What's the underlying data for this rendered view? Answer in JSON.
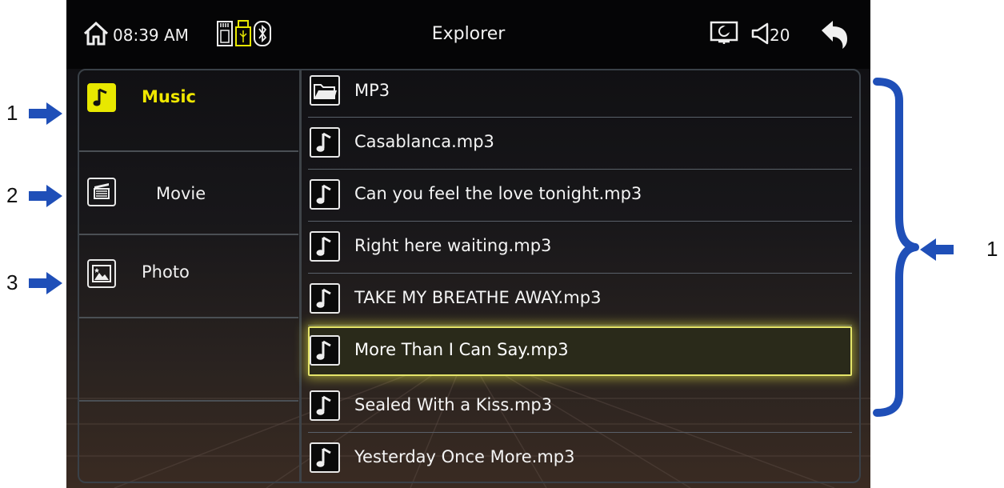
{
  "status_bar": {
    "time": "08:39 AM",
    "title": "Explorer",
    "volume": "20",
    "icons": [
      "home-icon",
      "sd-card-icon",
      "usb-icon",
      "bluetooth-icon",
      "screen-mode-icon",
      "volume-icon",
      "back-icon"
    ]
  },
  "categories": [
    {
      "label": "Music",
      "icon": "music-note-icon",
      "active": true
    },
    {
      "label": "Movie",
      "icon": "film-clapper-icon",
      "active": false
    },
    {
      "label": "Photo",
      "icon": "photo-icon",
      "active": false
    }
  ],
  "files": [
    {
      "name": "MP3",
      "icon": "folder-icon"
    },
    {
      "name": "Casablanca.mp3",
      "icon": "music-note-icon"
    },
    {
      "name": "Can you feel the love tonight.mp3",
      "icon": "music-note-icon"
    },
    {
      "name": "Right here waiting.mp3",
      "icon": "music-note-icon"
    },
    {
      "name": "TAKE MY BREATHE AWAY.mp3",
      "icon": "music-note-icon"
    },
    {
      "name": "More Than I Can Say.mp3",
      "icon": "music-note-icon",
      "selected": true
    },
    {
      "name": "Sealed With a Kiss.mp3",
      "icon": "music-note-icon"
    },
    {
      "name": "Yesterday Once More.mp3",
      "icon": "music-note-icon"
    }
  ],
  "annotations": {
    "left_numbers": [
      "1",
      "2",
      "3"
    ],
    "right_number": "1"
  },
  "colors": {
    "accent": "#e8e800",
    "annotation_blue": "#1f4fb8"
  }
}
